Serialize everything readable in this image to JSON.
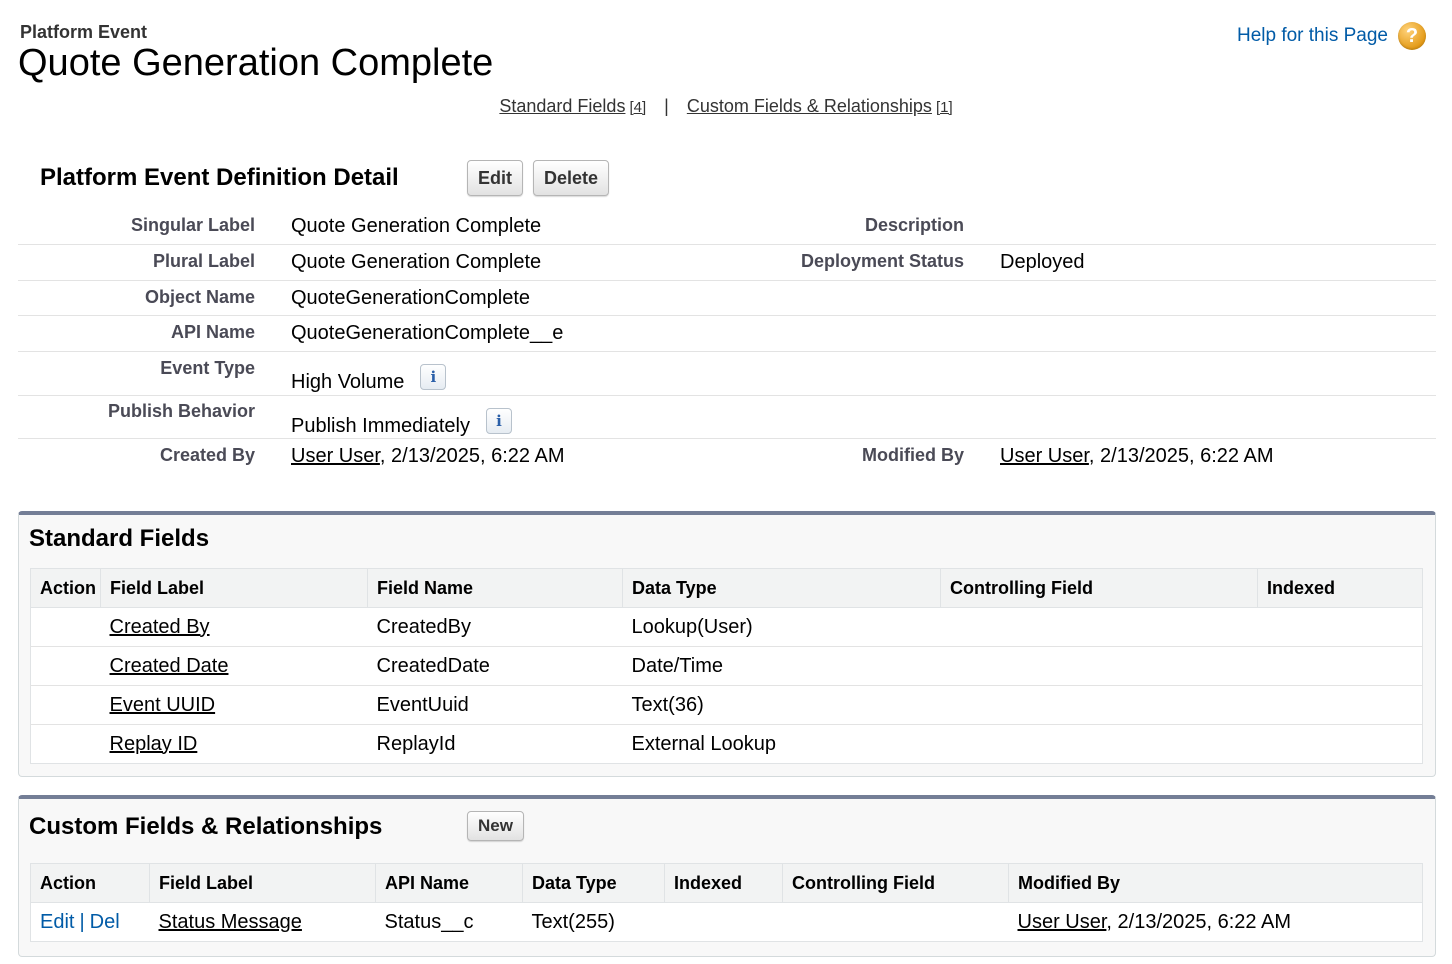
{
  "header": {
    "object_type": "Platform Event",
    "title": "Quote Generation Complete",
    "help_link": "Help for this Page",
    "related_links": [
      {
        "label": "Standard Fields",
        "count": "[4]"
      },
      {
        "label": "Custom Fields & Relationships",
        "count": "[1]"
      }
    ],
    "separator": "|"
  },
  "detail": {
    "title": "Platform Event Definition Detail",
    "edit_label": "Edit",
    "delete_label": "Delete",
    "fields": {
      "singular_label": {
        "label": "Singular Label",
        "value": "Quote Generation Complete"
      },
      "plural_label": {
        "label": "Plural Label",
        "value": "Quote Generation Complete"
      },
      "object_name": {
        "label": "Object Name",
        "value": "QuoteGenerationComplete"
      },
      "api_name": {
        "label": "API Name",
        "value": "QuoteGenerationComplete__e"
      },
      "event_type": {
        "label": "Event Type",
        "value": "High Volume"
      },
      "publish_behavior": {
        "label": "Publish Behavior",
        "value": "Publish Immediately"
      },
      "created_by": {
        "label": "Created By",
        "user": "User User",
        "date": ", 2/13/2025, 6:22 AM"
      },
      "description": {
        "label": "Description",
        "value": ""
      },
      "deployment_status": {
        "label": "Deployment Status",
        "value": "Deployed"
      },
      "modified_by": {
        "label": "Modified By",
        "user": "User User",
        "date": ", 2/13/2025, 6:22 AM"
      }
    },
    "info_icon_glyph": "i"
  },
  "standard_fields": {
    "title": "Standard Fields",
    "columns": [
      "Action",
      "Field Label",
      "Field Name",
      "Data Type",
      "Controlling Field",
      "Indexed"
    ],
    "rows": [
      {
        "label": "Created By",
        "name": "CreatedBy",
        "type": "Lookup(User)"
      },
      {
        "label": "Created Date",
        "name": "CreatedDate",
        "type": "Date/Time"
      },
      {
        "label": "Event UUID",
        "name": "EventUuid",
        "type": "Text(36)"
      },
      {
        "label": "Replay ID",
        "name": "ReplayId",
        "type": "External Lookup"
      }
    ]
  },
  "custom_fields": {
    "title": "Custom Fields & Relationships",
    "new_label": "New",
    "columns": [
      "Action",
      "Field Label",
      "API Name",
      "Data Type",
      "Indexed",
      "Controlling Field",
      "Modified By"
    ],
    "rows": [
      {
        "edit": "Edit",
        "sep": "|",
        "del": "Del",
        "label": "Status Message",
        "api": "Status__c",
        "type": "Text(255)",
        "indexed": "",
        "controlling": "",
        "mod_user": "User User",
        "mod_date": ", 2/13/2025, 6:22 AM"
      }
    ]
  },
  "colors": {
    "link_blue": "#015ba7",
    "section_border": "#747e96",
    "help_icon": "#e39a17"
  }
}
